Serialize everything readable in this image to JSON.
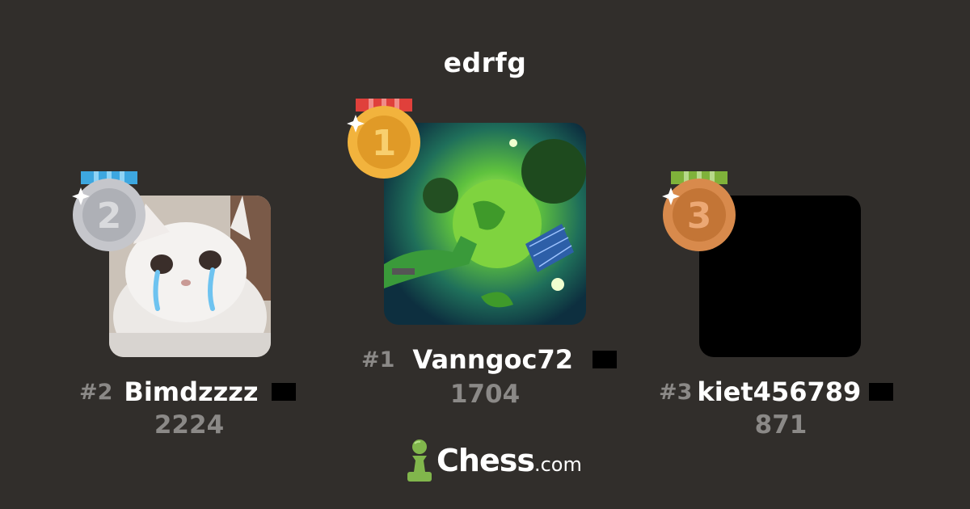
{
  "title": "edrfg",
  "podium": [
    {
      "place": 2,
      "rank_label": "#2",
      "username": "Bimdzzzz",
      "score": "2224",
      "medal_digit": "2",
      "medal_color": "#c5c6cb",
      "ribbon_color": "#3da7e0",
      "avatar": "sad-cat-avatar"
    },
    {
      "place": 1,
      "rank_label": "#1",
      "username": "Vanngoc72",
      "score": "1704",
      "medal_digit": "1",
      "medal_color": "#f2b33d",
      "ribbon_color": "#e0403b",
      "avatar": "green-energy-avatar"
    },
    {
      "place": 3,
      "rank_label": "#3",
      "username": "kiet456789",
      "score": "871",
      "medal_digit": "3",
      "medal_color": "#d88a4c",
      "ribbon_color": "#7fb23a",
      "avatar": "black-avatar"
    }
  ],
  "logo": {
    "brand": "Chess",
    "domain": ".com",
    "accent": "#81b64c"
  }
}
